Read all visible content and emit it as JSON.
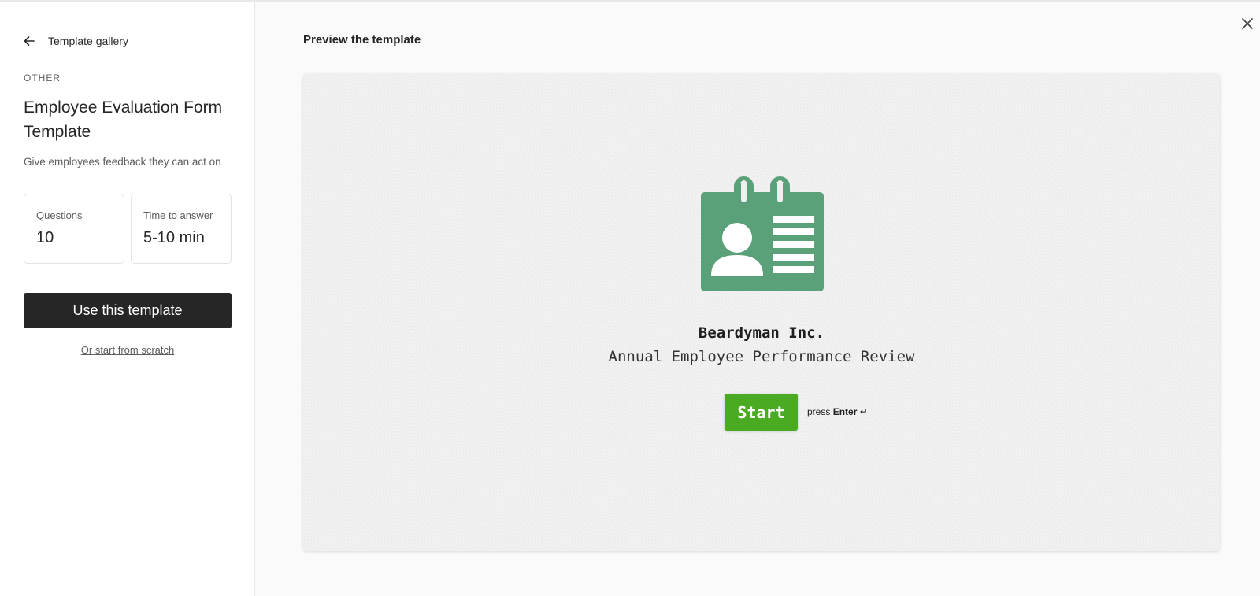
{
  "sidebar": {
    "back_label": "Template gallery",
    "category": "OTHER",
    "title": "Employee Evaluation Form Template",
    "subtitle": "Give employees feedback they can act on",
    "stats": {
      "questions_label": "Questions",
      "questions_value": "10",
      "time_label": "Time to answer",
      "time_value": "5-10 min"
    },
    "use_button": "Use this template",
    "scratch_link": "Or start from scratch"
  },
  "main": {
    "heading": "Preview the template",
    "preview": {
      "icon": "id-badge-icon",
      "icon_color": "#5aa079",
      "company": "Beardyman Inc.",
      "form_title": "Annual Employee Performance Review",
      "start_button": "Start",
      "start_color": "#4aaa22",
      "press_prefix": "press",
      "press_key": "Enter",
      "enter_symbol": "↵"
    }
  },
  "icons": {
    "back": "arrow-left-icon",
    "close": "close-icon"
  }
}
